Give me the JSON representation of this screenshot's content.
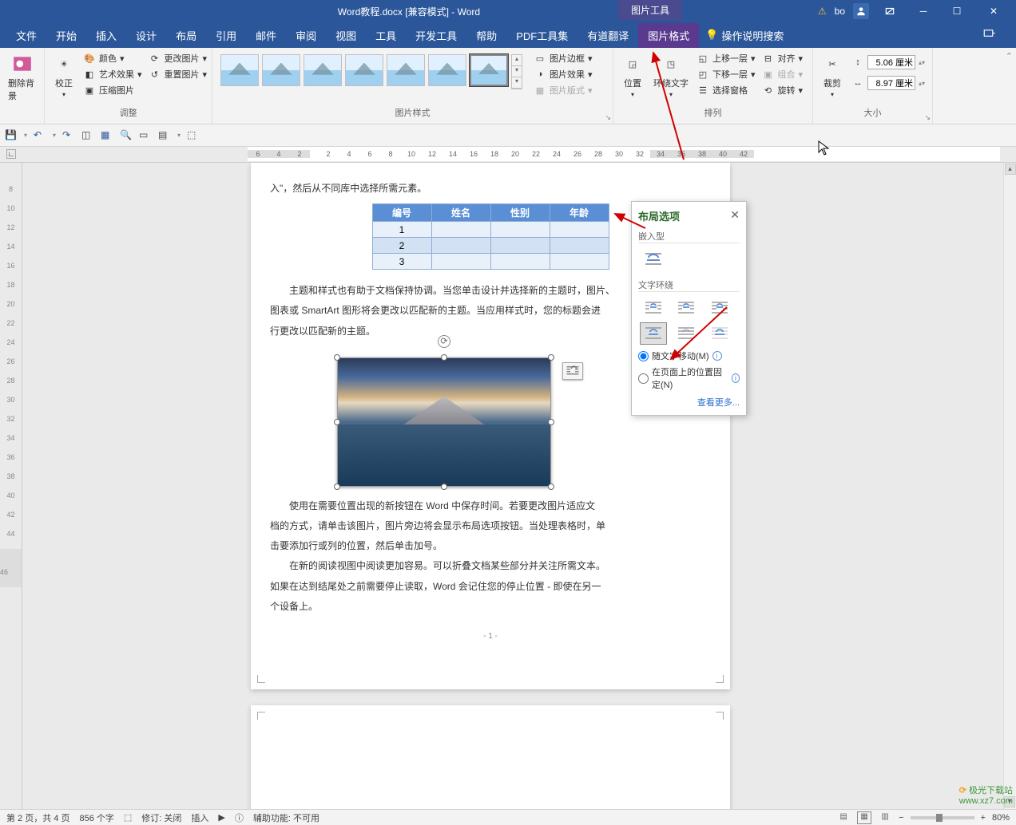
{
  "title_bar": {
    "doc_title": "Word教程.docx [兼容模式] - Word",
    "context_tool": "图片工具",
    "user": "bo",
    "warn_icon": "⚠"
  },
  "tabs": {
    "file": "文件",
    "home": "开始",
    "insert": "插入",
    "design": "设计",
    "layout": "布局",
    "references": "引用",
    "mailings": "邮件",
    "review": "审阅",
    "view": "视图",
    "tools": "工具",
    "developer": "开发工具",
    "help": "帮助",
    "pdf": "PDF工具集",
    "youdao": "有道翻译",
    "picture_format": "图片格式",
    "tell_me": "操作说明搜索"
  },
  "ribbon": {
    "remove_bg": "删除背景",
    "corrections": "校正",
    "color": "颜色",
    "artistic": "艺术效果",
    "compress": "压缩图片",
    "change_pic": "更改图片",
    "reset_pic": "重置图片",
    "adjust_group": "调整",
    "styles_group": "图片样式",
    "border": "图片边框",
    "effects": "图片效果",
    "layout_caption": "图片版式",
    "position": "位置",
    "wrap_text": "环绕文字",
    "bring_fwd": "上移一层",
    "send_back": "下移一层",
    "selection_pane": "选择窗格",
    "align": "对齐",
    "group": "组合",
    "rotate": "旋转",
    "arrange_group": "排列",
    "crop": "裁剪",
    "height": "5.06 厘米",
    "width": "8.97 厘米",
    "size_group": "大小"
  },
  "ruler_h": [
    "6",
    "4",
    "2",
    "",
    "2",
    "4",
    "6",
    "8",
    "10",
    "12",
    "14",
    "16",
    "18",
    "20",
    "22",
    "24",
    "26",
    "28",
    "30",
    "32",
    "34",
    "36",
    "38",
    "40",
    "42"
  ],
  "ruler_v": [
    "",
    "8",
    "10",
    "12",
    "14",
    "16",
    "18",
    "20",
    "22",
    "24",
    "26",
    "28",
    "30",
    "32",
    "34",
    "36",
    "38",
    "40",
    "42",
    "44",
    "",
    "46"
  ],
  "doc": {
    "line1": "入\"，然后从不同库中选择所需元素。",
    "table_head": [
      "编号",
      "姓名",
      "性别",
      "年龄"
    ],
    "table_rows": [
      "1",
      "2",
      "3"
    ],
    "para2a": "主题和样式也有助于文档保持协调。当您单击设计并选择新的主题时，图片、",
    "para2b": "图表或 SmartArt 图形将会更改以匹配新的主题。当应用样式时，您的标题会进",
    "para2c": "行更改以匹配新的主题。",
    "para3a": "使用在需要位置出现的新按钮在 Word 中保存时间。若要更改图片适应文",
    "para3b": "档的方式，请单击该图片，图片旁边将会显示布局选项按钮。当处理表格时，单",
    "para3c": "击要添加行或列的位置，然后单击加号。",
    "para4a": "在新的阅读视图中阅读更加容易。可以折叠文档某些部分并关注所需文本。",
    "para4b": "如果在达到结尾处之前需要停止读取，Word 会记住您的停止位置 - 即使在另一",
    "para4c": "个设备上。",
    "page_num": "- 1 -"
  },
  "layout_popup": {
    "title": "布局选项",
    "inline": "嵌入型",
    "text_wrap": "文字环绕",
    "move_with_text": "随文字移动(M)",
    "fix_on_page": "在页面上的位置固定(N)",
    "see_more": "查看更多..."
  },
  "status": {
    "page": "第 2 页，共 4 页",
    "words": "856 个字",
    "track": "修订: 关闭",
    "mode": "插入",
    "accessibility": "辅助功能: 不可用",
    "zoom": "80%"
  },
  "watermark": {
    "l1": "极光下载站",
    "l2": "www.xz7.com"
  }
}
